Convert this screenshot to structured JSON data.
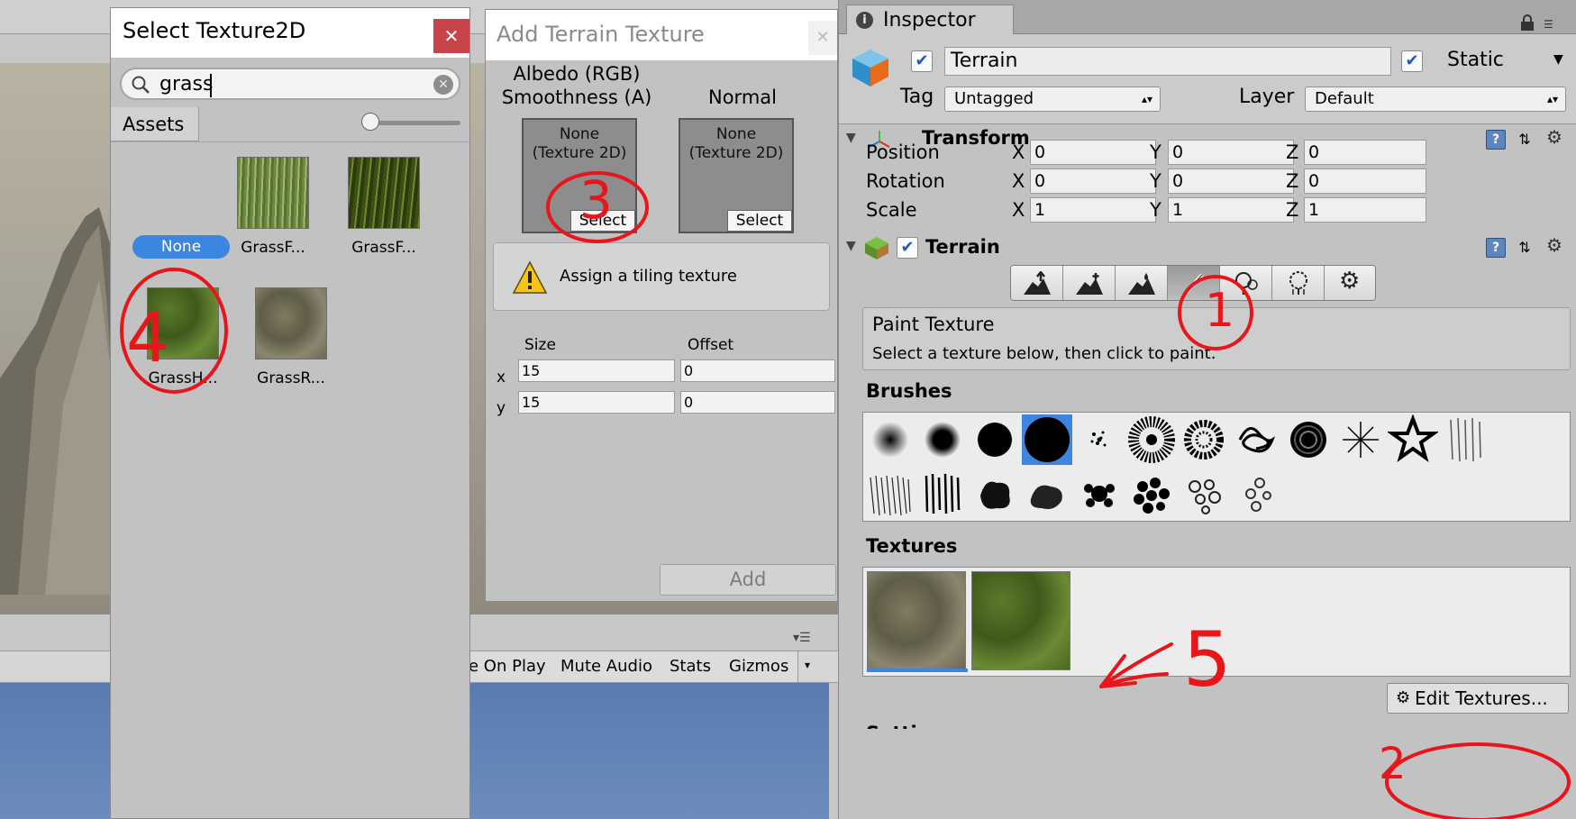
{
  "select_window": {
    "title": "Select Texture2D",
    "close": "✕",
    "search_value": "grass",
    "tab": "Assets",
    "none_label": "None",
    "items": [
      {
        "label": "GrassF..."
      },
      {
        "label": "GrassF..."
      },
      {
        "label": "GrassH..."
      },
      {
        "label": "GrassR..."
      }
    ]
  },
  "add_window": {
    "title": "Add Terrain Texture",
    "close": "✕",
    "albedo_label_1": "Albedo (RGB)",
    "albedo_label_2": "Smoothness (A)",
    "normal_label": "Normal",
    "slot_none_1": "None",
    "slot_none_2": "(Texture 2D)",
    "select_label": "Select",
    "tiling_help": "Assign a tiling texture",
    "size_label": "Size",
    "offset_label": "Offset",
    "x_label": "x",
    "y_label": "y",
    "size_x": "15",
    "size_y": "15",
    "offset_x": "0",
    "offset_y": "0",
    "add_label": "Add"
  },
  "game_bar": {
    "items": [
      "e On Play",
      "Mute Audio",
      "Stats",
      "Gizmos"
    ]
  },
  "inspector": {
    "tab": "Inspector",
    "tab_icon": "i",
    "object_name": "Terrain",
    "static_label": "Static",
    "tag_label": "Tag",
    "tag_value": "Untagged",
    "layer_label": "Layer",
    "layer_value": "Default",
    "transform": {
      "title": "Transform",
      "rows": [
        {
          "label": "Position",
          "x": "0",
          "y": "0",
          "z": "0"
        },
        {
          "label": "Rotation",
          "x": "0",
          "y": "0",
          "z": "0"
        },
        {
          "label": "Scale",
          "x": "1",
          "y": "1",
          "z": "1"
        }
      ],
      "axis_x": "X",
      "axis_y": "Y",
      "axis_z": "Z"
    },
    "terrain": {
      "title": "Terrain",
      "paint_title": "Paint Texture",
      "paint_desc": "Select a texture below, then click to paint.",
      "brushes_title": "Brushes",
      "textures_title": "Textures",
      "edit_textures": "Edit Textures...",
      "settings_title": "Settings"
    }
  },
  "annotations": {
    "n1": "1",
    "n2": "2",
    "n3": "3",
    "n4": "4",
    "n5": "5"
  },
  "colors": {
    "accent": "#3d86e0",
    "annotation": "#e8151b",
    "close_red": "#c8434a"
  }
}
